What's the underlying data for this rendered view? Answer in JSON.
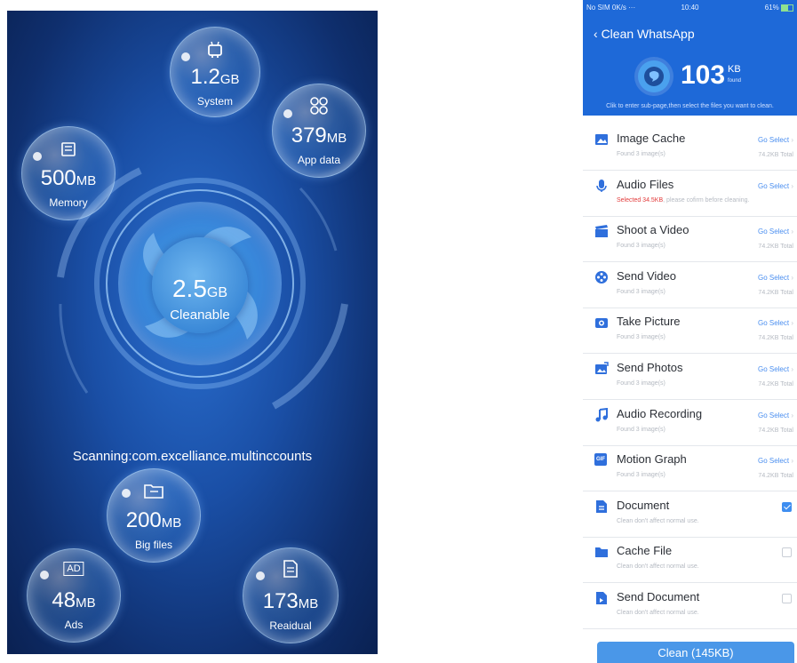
{
  "left": {
    "scanning_text": "Scanning:com.excelliance.multinccounts",
    "center": {
      "value": "2.5",
      "unit": "GB",
      "label": "Cleanable"
    },
    "bubbles": [
      {
        "key": "system",
        "value": "1.2",
        "unit": "GB",
        "label": "System",
        "icon": "android-icon"
      },
      {
        "key": "appdata",
        "value": "379",
        "unit": "MB",
        "label": "App data",
        "icon": "apps-icon"
      },
      {
        "key": "memory",
        "value": "500",
        "unit": "MB",
        "label": "Memory",
        "icon": "memory-chip-icon"
      },
      {
        "key": "bigfiles",
        "value": "200",
        "unit": "MB",
        "label": "Big files",
        "icon": "folder-icon"
      },
      {
        "key": "ads",
        "value": "48",
        "unit": "MB",
        "label": "Ads",
        "icon": "ad-icon",
        "icon_text": "AD"
      },
      {
        "key": "residual",
        "value": "173",
        "unit": "MB",
        "label": "Reaidual",
        "icon": "document-icon"
      }
    ]
  },
  "right": {
    "status": {
      "left": "No SIM 0K/s ···",
      "time": "10:40",
      "right": "61%"
    },
    "title": "Clean WhatsApp",
    "found": {
      "value": "103",
      "unit": "KB",
      "sub": "found"
    },
    "hint": "Clik to enter sub-page,then select the files you want to clean.",
    "go_label": "Go Select",
    "items": [
      {
        "title": "Image Cache",
        "sub": "Found 3 image(s)",
        "total": "74.2KB Total",
        "icon": "image-icon"
      },
      {
        "title": "Audio Files",
        "sub_hl": "Selected 34.5KB",
        "sub": ", please cofirm before cleaning.",
        "total": "",
        "icon": "microphone-icon"
      },
      {
        "title": "Shoot a Video",
        "sub": "Found 3 image(s)",
        "total": "74.2KB Total",
        "icon": "clapper-icon"
      },
      {
        "title": "Send Video",
        "sub": "Found 3 image(s)",
        "total": "74.2KB Total",
        "icon": "film-reel-icon"
      },
      {
        "title": "Take Picture",
        "sub": "Found 3 image(s)",
        "total": "74.2KB Total",
        "icon": "camera-icon"
      },
      {
        "title": "Send Photos",
        "sub": "Found 3 image(s)",
        "total": "74.2KB Total",
        "icon": "photo-send-icon"
      },
      {
        "title": "Audio Recording",
        "sub": "Found 3 image(s)",
        "total": "74.2KB Total",
        "icon": "music-note-icon"
      },
      {
        "title": "Motion Graph",
        "sub": "Found 3 image(s)",
        "total": "74.2KB Total",
        "icon": "gif-icon",
        "icon_text": "GIF"
      },
      {
        "title": "Document",
        "sub": "Clean don't affect normal use.",
        "checked": true,
        "icon": "document-icon"
      },
      {
        "title": "Cache File",
        "sub": "Clean don't affect normal use.",
        "checked": false,
        "icon": "folder-icon"
      },
      {
        "title": "Send Document",
        "sub": "Clean don't affect normal use.",
        "checked": false,
        "icon": "document-send-icon"
      }
    ],
    "clean_button": "Clean (145KB)",
    "colors": {
      "header": "#1e69d8",
      "accent": "#4a97e8",
      "red": "#e23b3b"
    }
  }
}
